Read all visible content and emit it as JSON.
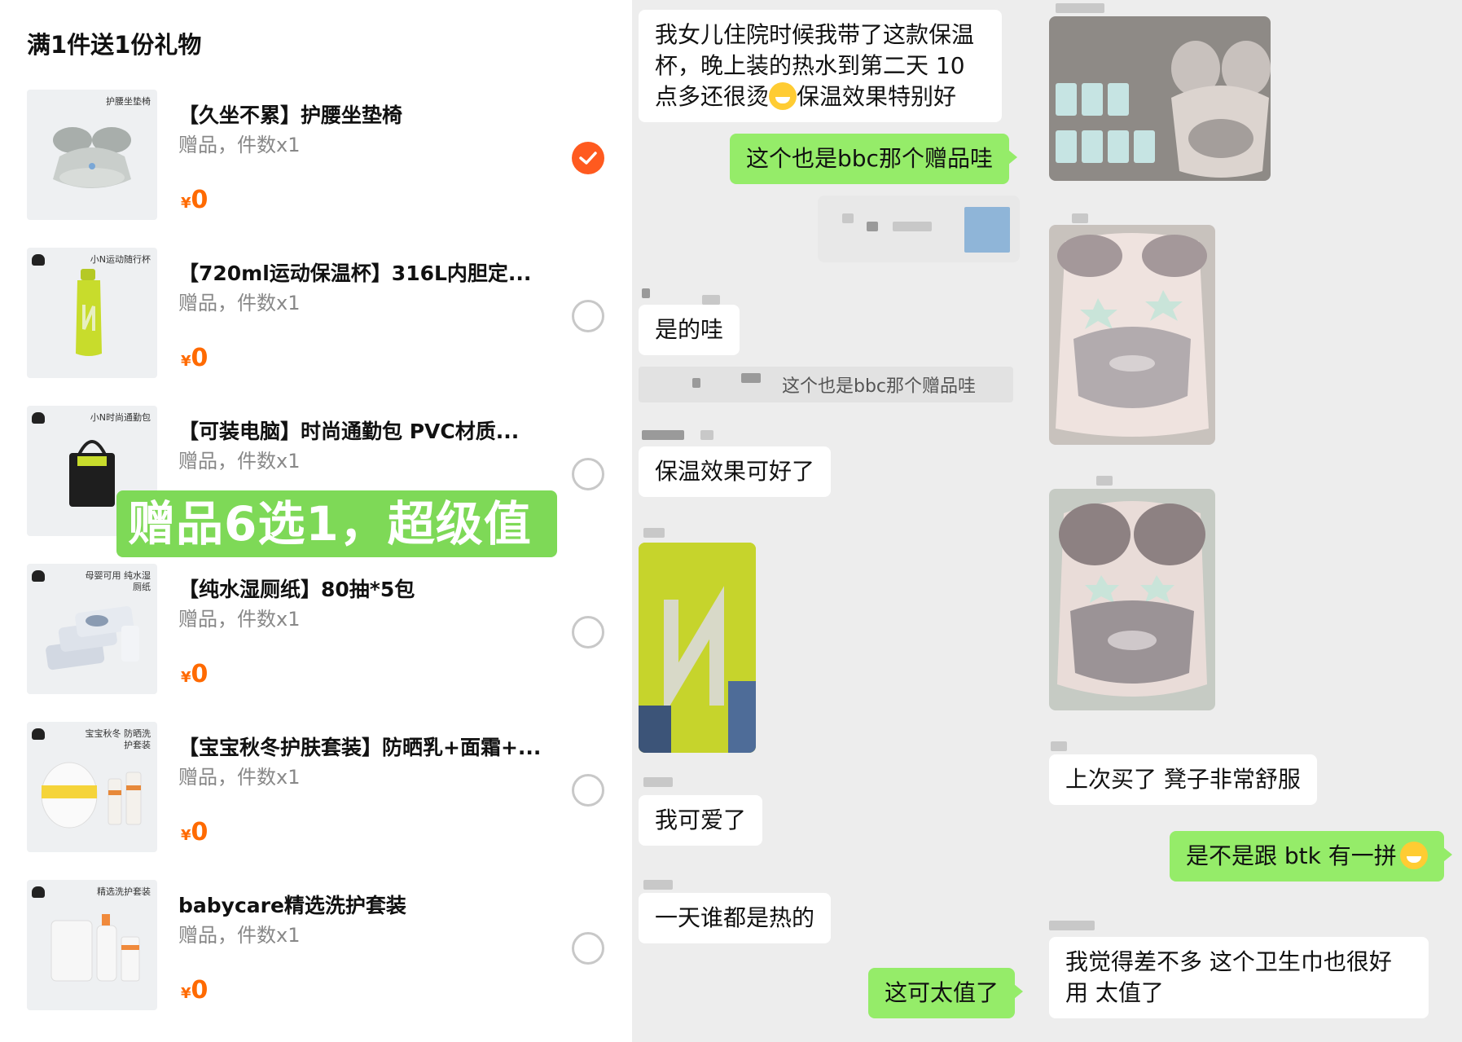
{
  "gift_panel": {
    "title": "满1件送1份礼物",
    "promo_banner": "赠品6选1，超级值",
    "currency": "¥",
    "items": [
      {
        "name": "【久坐不累】护腰坐垫椅",
        "sub": "赠品，件数x1",
        "price": "0",
        "thumb_tag": "护腰坐垫椅",
        "selected": true,
        "icon": "cushion-icon",
        "accent": "#b9bdbd"
      },
      {
        "name": "【720ml运动保温杯】316L内胆定...",
        "sub": "赠品，件数x1",
        "price": "0",
        "thumb_tag": "小N运动随行杯",
        "selected": false,
        "icon": "tumbler-icon",
        "accent": "#c8dc2c"
      },
      {
        "name": "【可装电脑】时尚通勤包 PVC材质...",
        "sub": "赠品，件数x1",
        "price": "0",
        "thumb_tag": "小N时尚通勤包",
        "selected": false,
        "icon": "tote-bag-icon",
        "accent": "#222222"
      },
      {
        "name": "【纯水湿厕纸】80抽*5包",
        "sub": "赠品，件数x1",
        "price": "0",
        "thumb_tag": "母婴可用 纯水湿厕纸",
        "selected": false,
        "icon": "wipes-icon",
        "accent": "#d9dee6"
      },
      {
        "name": "【宝宝秋冬护肤套装】防晒乳+面霜+...",
        "sub": "赠品，件数x1",
        "price": "0",
        "thumb_tag": "宝宝秋冬 防晒洗护套装",
        "selected": false,
        "icon": "skincare-icon",
        "accent": "#f5d43a"
      },
      {
        "name": "babycare精选洗护套装",
        "sub": "赠品，件数x1",
        "price": "0",
        "thumb_tag": "精选洗护套装",
        "selected": false,
        "icon": "washcare-icon",
        "accent": "#f08a3c"
      }
    ]
  },
  "chat": {
    "messages": [
      {
        "from": "other",
        "text": "我女儿住院时候我带了这款保温杯，晚上装的热水到第二天 10 点多还很烫",
        "text_tail": "保温效果特别好"
      },
      {
        "from": "me",
        "text": "这个也是bbc那个赠品哇"
      },
      {
        "from": "other",
        "text": "是的哇"
      },
      {
        "from": "quote",
        "text": "这个也是bbc那个赠品哇"
      },
      {
        "from": "other",
        "text": "保温效果可好了"
      },
      {
        "from": "other",
        "text": "我可爱了"
      },
      {
        "from": "other",
        "text": "一天谁都是热的"
      },
      {
        "from": "me",
        "text": "这可太值了"
      },
      {
        "from": "other",
        "text": "上次买了 凳子非常舒服"
      },
      {
        "from": "me",
        "text": "是不是跟 btk 有一拼"
      },
      {
        "from": "other",
        "text": "我觉得差不多 这个卫生巾也很好用 太值了"
      }
    ],
    "colors": {
      "me_bubble": "#95ec69",
      "other_bubble": "#ffffff",
      "background": "#ededed"
    }
  }
}
